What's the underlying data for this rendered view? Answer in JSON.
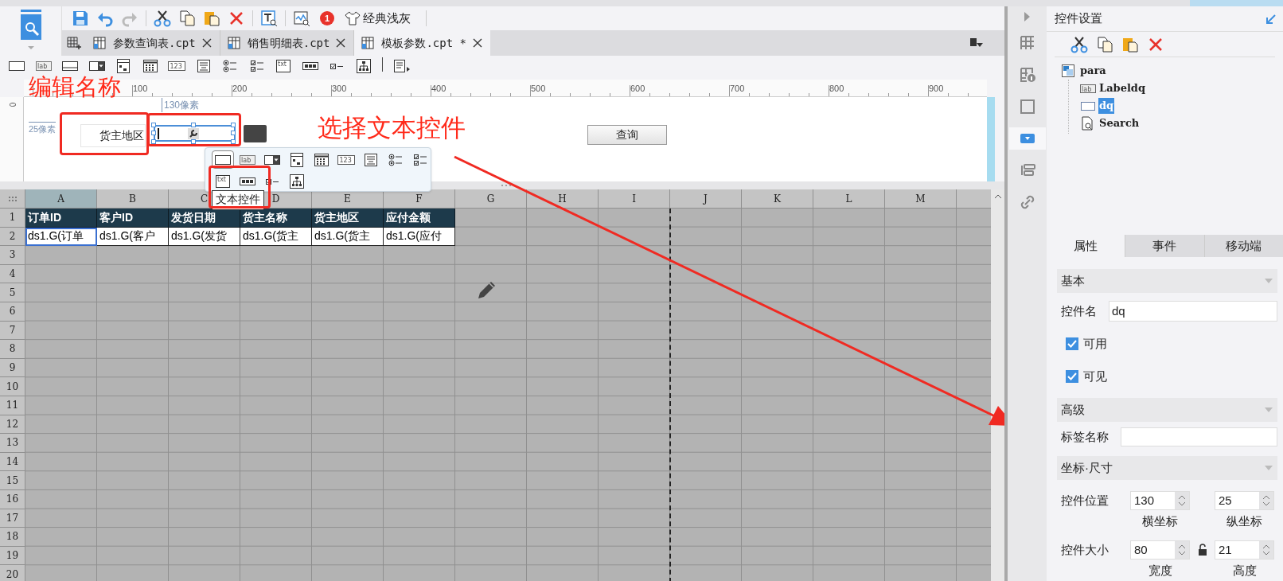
{
  "toolbar": {
    "theme": "经典浅灰",
    "badge": "1"
  },
  "tabs": [
    {
      "label": "参数查询表.cpt",
      "selected": false
    },
    {
      "label": "销售明细表.cpt",
      "selected": false
    },
    {
      "label": "模板参数.cpt *",
      "selected": true
    }
  ],
  "widget_toolbar": [
    {
      "kind": "textbox"
    },
    {
      "kind": "label",
      "text": "lab"
    },
    {
      "kind": "button"
    },
    {
      "kind": "combo"
    },
    {
      "kind": "date"
    },
    {
      "kind": "calendar"
    },
    {
      "kind": "number",
      "text": "123"
    },
    {
      "kind": "textarea"
    },
    {
      "kind": "radio"
    },
    {
      "kind": "checkgroup"
    },
    {
      "kind": "text",
      "text": "txt"
    },
    {
      "kind": "password"
    },
    {
      "kind": "checkbox"
    },
    {
      "kind": "tree"
    },
    {
      "kind": "more"
    }
  ],
  "ruler": {
    "origin": "0",
    "marks": [
      "100",
      "200",
      "300",
      "400",
      "500",
      "600",
      "700",
      "800",
      "900"
    ]
  },
  "parameter_canvas": {
    "width_hint": "130像素",
    "height_hint": "25像素",
    "label_widget": "货主地区",
    "textbox_selected": true,
    "query_button": "查询"
  },
  "widget_popup": {
    "items": [
      {
        "kind": "textbox",
        "selected": true
      },
      {
        "kind": "label",
        "text": "lab",
        "selected": false
      },
      {
        "kind": "combo",
        "selected": false
      },
      {
        "kind": "date",
        "selected": false
      },
      {
        "kind": "calendar",
        "selected": false
      },
      {
        "kind": "number",
        "text": "123",
        "selected": false
      },
      {
        "kind": "textarea",
        "selected": false
      },
      {
        "kind": "radio",
        "selected": false
      },
      {
        "kind": "checkgroup",
        "selected": false
      },
      {
        "kind": "text",
        "text": "txt",
        "selected": false
      },
      {
        "kind": "password",
        "selected": false
      },
      {
        "kind": "checkbox",
        "selected": false
      },
      {
        "kind": "tree",
        "selected": false
      }
    ],
    "tooltip": "文本控件"
  },
  "annotations": [
    {
      "kind": "note",
      "text": "编辑名称"
    },
    {
      "kind": "note",
      "text": "选择文本控件"
    }
  ],
  "sheet": {
    "columns": [
      {
        "label": "A",
        "selected": true
      },
      {
        "label": "B",
        "selected": false
      },
      {
        "label": "C",
        "selected": false
      },
      {
        "label": "D",
        "selected": false
      },
      {
        "label": "E",
        "selected": false
      },
      {
        "label": "F",
        "selected": false
      },
      {
        "label": "G",
        "selected": false
      },
      {
        "label": "H",
        "selected": false
      },
      {
        "label": "I",
        "selected": false
      },
      {
        "label": "J",
        "selected": false
      },
      {
        "label": "K",
        "selected": false
      },
      {
        "label": "L",
        "selected": false
      },
      {
        "label": "M",
        "selected": false
      }
    ],
    "rows": [
      {
        "label": "1",
        "kind": "header",
        "cells": [
          {
            "text": "订单ID",
            "selected": false
          },
          {
            "text": "客户ID",
            "selected": false
          },
          {
            "text": "发货日期",
            "selected": false
          },
          {
            "text": "货主名称",
            "selected": false
          },
          {
            "text": "货主地区",
            "selected": false
          },
          {
            "text": "应付金额",
            "selected": false
          }
        ]
      },
      {
        "label": "2",
        "kind": "data",
        "cells": [
          {
            "text": "ds1.G(订单",
            "selected": true
          },
          {
            "text": "ds1.G(客户",
            "selected": false
          },
          {
            "text": "ds1.G(发货",
            "selected": false
          },
          {
            "text": "ds1.G(货主",
            "selected": false
          },
          {
            "text": "ds1.G(货主",
            "selected": false
          },
          {
            "text": "ds1.G(应付",
            "selected": false
          }
        ]
      },
      {
        "label": "3"
      },
      {
        "label": "4"
      },
      {
        "label": "5"
      },
      {
        "label": "6"
      },
      {
        "label": "7"
      },
      {
        "label": "8"
      },
      {
        "label": "9"
      },
      {
        "label": "10"
      },
      {
        "label": "11"
      },
      {
        "label": "12"
      },
      {
        "label": "13"
      },
      {
        "label": "14"
      },
      {
        "label": "15"
      },
      {
        "label": "16"
      },
      {
        "label": "17"
      },
      {
        "label": "18"
      },
      {
        "label": "19"
      },
      {
        "label": "20"
      }
    ]
  },
  "side_tools": [
    {
      "kind": "cell",
      "selected": false
    },
    {
      "kind": "cell-info",
      "selected": false
    },
    {
      "kind": "frame",
      "selected": false
    },
    {
      "kind": "widget",
      "selected": true
    },
    {
      "kind": "form",
      "selected": false
    },
    {
      "kind": "link",
      "selected": false
    }
  ],
  "panel": {
    "title": "控件设置",
    "tree": {
      "label": "para",
      "kind": "container",
      "children": [
        {
          "label": "Labeldq",
          "kind": "label",
          "icon_text": "lab",
          "selected": false
        },
        {
          "label": "dq",
          "kind": "textbox",
          "selected": true
        },
        {
          "label": "Search",
          "kind": "search",
          "selected": false
        }
      ]
    },
    "tabs": [
      {
        "label": "属性",
        "selected": true
      },
      {
        "label": "事件",
        "selected": false
      },
      {
        "label": "移动端",
        "selected": false
      }
    ],
    "basic": {
      "title": "基本",
      "expanded": true,
      "name_label": "控件名",
      "name_value": "dq",
      "checks": [
        {
          "label": "可用",
          "checked": true
        },
        {
          "label": "可见",
          "checked": true
        }
      ]
    },
    "advanced": {
      "title": "高级",
      "expanded": true,
      "tag_label": "标签名称"
    },
    "geometry": {
      "title": "坐标·尺寸",
      "expanded": true,
      "rows": [
        {
          "kind": "position",
          "label": "控件位置",
          "values": [
            "130",
            "25"
          ],
          "captions": [
            "横坐标",
            "纵坐标"
          ]
        },
        {
          "kind": "size",
          "label": "控件大小",
          "values": [
            "80",
            "21"
          ],
          "captions": [
            "宽度",
            "高度"
          ]
        }
      ]
    }
  }
}
